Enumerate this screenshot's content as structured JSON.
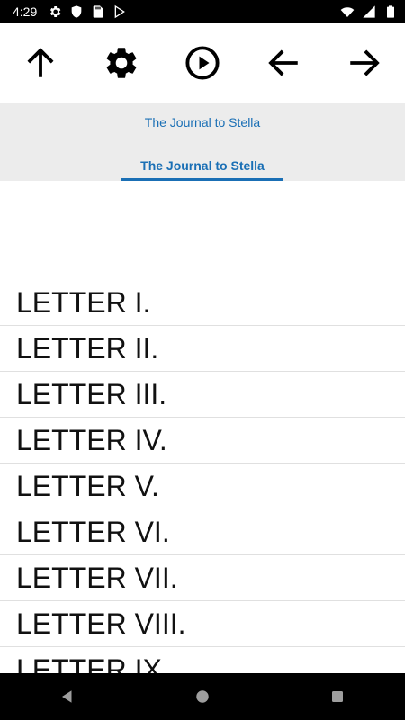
{
  "status_bar": {
    "time": "4:29",
    "left_icons": [
      "gear-icon",
      "shield-icon",
      "sd-card-icon",
      "play-store-icon"
    ],
    "right_icons": [
      "wifi-icon",
      "signal-icon",
      "battery-icon"
    ]
  },
  "toolbar": {
    "buttons": [
      "up-arrow-icon",
      "gear-icon",
      "play-circle-icon",
      "back-arrow-icon",
      "forward-arrow-icon"
    ]
  },
  "header": {
    "book_title": "The Journal to Stella",
    "tab_label": "The Journal to Stella",
    "accent_color": "#1a6fb5"
  },
  "chapters": {
    "items": [
      "LETTER I.",
      "LETTER II.",
      "LETTER III.",
      "LETTER IV.",
      "LETTER V.",
      "LETTER VI.",
      "LETTER VII.",
      "LETTER VIII.",
      "LETTER IX."
    ]
  },
  "nav_bar": {
    "buttons": [
      "back-triangle-icon",
      "home-circle-icon",
      "recents-square-icon"
    ]
  }
}
